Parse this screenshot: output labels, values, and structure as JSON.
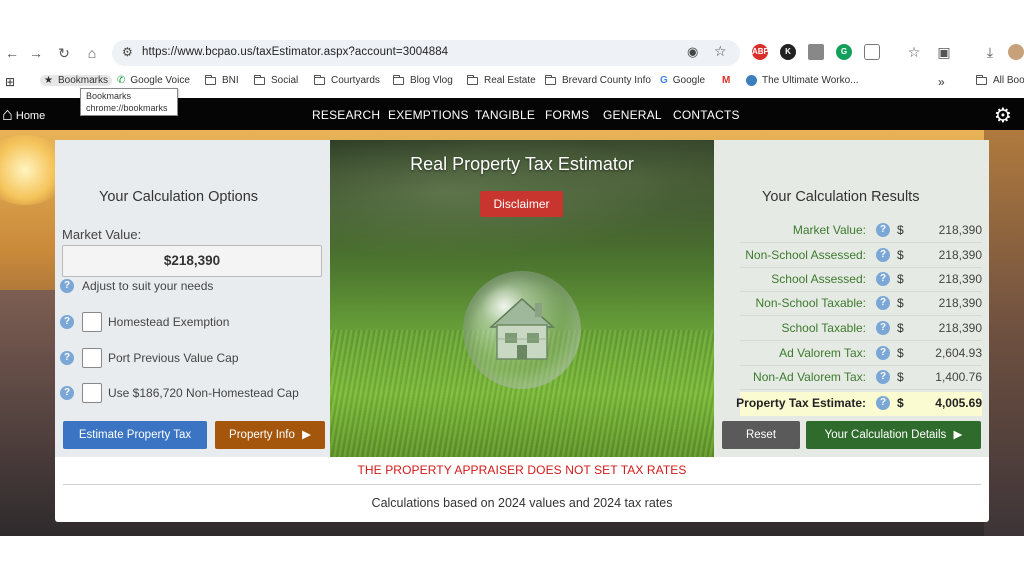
{
  "browser": {
    "url": "https://www.bcpao.us/taxEstimator.aspx?account=3004884",
    "extensions": [
      "ABP",
      "K",
      "",
      "G",
      ""
    ],
    "bookmarks": [
      {
        "label": "Bookmarks",
        "icon": "star-icon"
      },
      {
        "label": "Google Voice",
        "icon": "phone-icon"
      },
      {
        "label": "BNI",
        "icon": "folder-icon"
      },
      {
        "label": "Social",
        "icon": "folder-icon"
      },
      {
        "label": "Courtyards",
        "icon": "folder-icon"
      },
      {
        "label": "Blog Vlog",
        "icon": "folder-icon"
      },
      {
        "label": "Real Estate",
        "icon": "folder-icon"
      },
      {
        "label": "Brevard County Info",
        "icon": "folder-icon"
      },
      {
        "label": "Google",
        "icon": "google-icon"
      },
      {
        "label": "",
        "icon": "gmail-icon"
      },
      {
        "label": "The Ultimate Worko...",
        "icon": "site-icon"
      },
      {
        "label": "»",
        "icon": "overflow-icon"
      },
      {
        "label": "All Boo",
        "icon": "folder-icon"
      }
    ],
    "tooltip": {
      "line1": "Bookmarks",
      "line2": "chrome://bookmarks"
    }
  },
  "site_nav": {
    "home_label": "Home",
    "items": [
      "RESEARCH",
      "EXEMPTIONS",
      "TANGIBLE",
      "FORMS",
      "GENERAL",
      "CONTACTS"
    ]
  },
  "options": {
    "title": "Your Calculation Options",
    "market_value_label": "Market Value:",
    "market_value": "$218,390",
    "adjust_hint": "Adjust to suit your needs",
    "checkboxes": [
      {
        "label": "Homestead Exemption",
        "checked": false
      },
      {
        "label": "Port Previous Value Cap",
        "checked": false
      },
      {
        "label": "Use $186,720 Non-Homestead Cap",
        "checked": false
      }
    ],
    "estimate_button": "Estimate Property Tax",
    "property_info_button": "Property Info"
  },
  "center": {
    "title": "Real Property Tax Estimator",
    "disclaimer_button": "Disclaimer"
  },
  "results": {
    "title": "Your Calculation Results",
    "currency": "$",
    "rows": [
      {
        "label": "Market Value:",
        "value": "218,390"
      },
      {
        "label": "Non-School Assessed:",
        "value": "218,390"
      },
      {
        "label": "School Assessed:",
        "value": "218,390"
      },
      {
        "label": "Non-School Taxable:",
        "value": "218,390"
      },
      {
        "label": "School Taxable:",
        "value": "218,390"
      },
      {
        "label": "Ad Valorem Tax:",
        "value": "2,604.93"
      },
      {
        "label": "Non-Ad Valorem Tax:",
        "value": "1,400.76"
      },
      {
        "label": "Property Tax Estimate:",
        "value": "4,005.69"
      }
    ],
    "reset_button": "Reset",
    "details_button": "Your Calculation Details"
  },
  "footer": {
    "warning": "THE PROPERTY APPRAISER DOES NOT SET TAX RATES",
    "note": "Calculations based on 2024 values and 2024 tax rates"
  },
  "colors": {
    "accent_blue": "#3a74c2",
    "accent_brown": "#a5560d",
    "accent_green": "#2e6b2c",
    "disclaimer_red": "#c8342e",
    "warning_red": "#d01a1a"
  }
}
